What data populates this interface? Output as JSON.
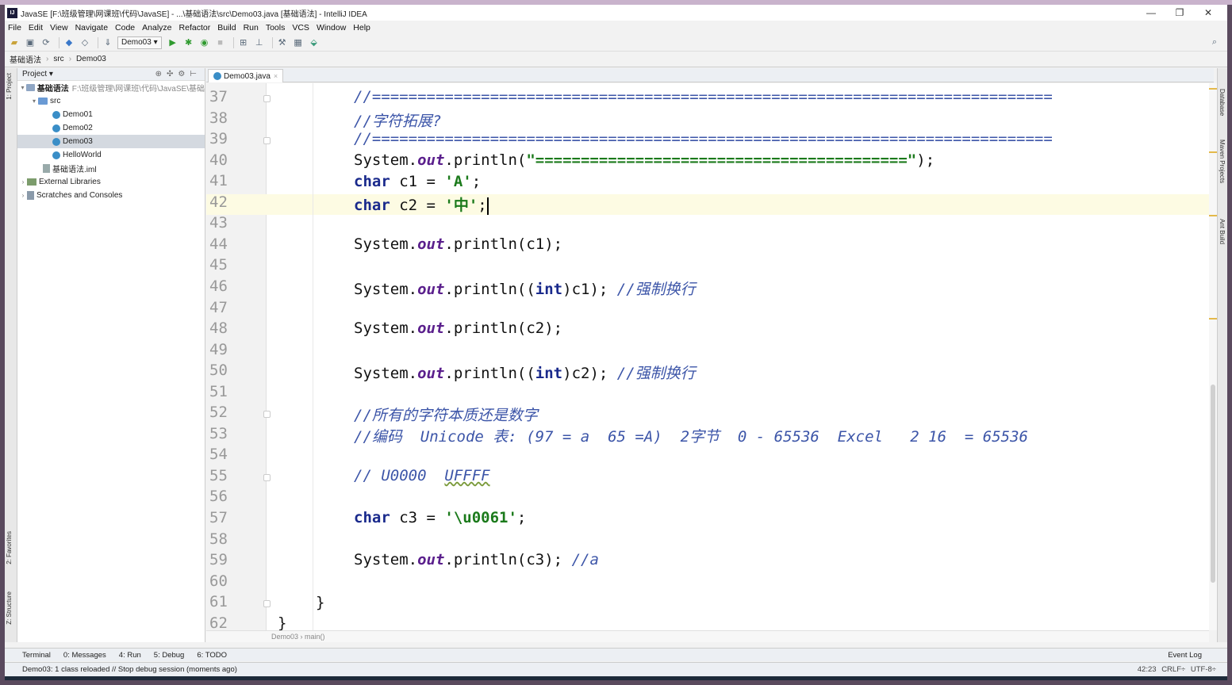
{
  "window": {
    "title": "JavaSE [F:\\班级管理\\网课班\\代码\\JavaSE] - ...\\基础语法\\src\\Demo03.java [基础语法] - IntelliJ IDEA",
    "controls": [
      "—",
      "❐",
      "✕"
    ]
  },
  "menu": [
    "File",
    "Edit",
    "View",
    "Navigate",
    "Code",
    "Analyze",
    "Refactor",
    "Build",
    "Run",
    "Tools",
    "VCS",
    "Window",
    "Help"
  ],
  "toolbar": {
    "run_config": "Demo03 ▾"
  },
  "breadcrumbs": [
    "基础语法",
    "src",
    "Demo03"
  ],
  "left_stripe": {
    "project": "1: Project",
    "favorites": "2: Favorites",
    "structure": "Z: Structure"
  },
  "project_panel": {
    "title": "Project ▾",
    "root": {
      "name": "基础语法",
      "path": "F:\\班级管理\\网课班\\代码\\JavaSE\\基础"
    },
    "src": "src",
    "files": [
      "Demo01",
      "Demo02",
      "Demo03",
      "HelloWorld"
    ],
    "iml": "基础语法.iml",
    "external": "External Libraries",
    "scratches": "Scratches and Consoles"
  },
  "editor": {
    "tab": "Demo03.java",
    "line_numbers": [
      "37",
      "38",
      "39",
      "40",
      "41",
      "42",
      "43",
      "44",
      "45",
      "46",
      "47",
      "48",
      "49",
      "50",
      "51",
      "52",
      "53",
      "54",
      "55",
      "56",
      "57",
      "58",
      "59",
      "60",
      "61",
      "62"
    ],
    "code": {
      "l37": "//===========================================================================",
      "l38": "//字符拓展?",
      "l39": "//===========================================================================",
      "l40_a": "System.",
      "l40_b": "out",
      "l40_c": ".println(",
      "l40_d": "\"=========================================\"",
      "l40_e": ");",
      "kw_char": "char",
      "l41_a": " c1 = ",
      "l41_b": "'A'",
      "l41_c": ";",
      "l42_a": " c2 = ",
      "l42_b": "'中'",
      "l42_c": ";",
      "l44_a": "System.",
      "l44_b": "out",
      "l44_c": ".println(c1);",
      "l46_a": "System.",
      "l46_b": "out",
      "l46_c": ".println((",
      "kw_int": "int",
      "l46_d": ")c1); ",
      "l46_e": "//强制换行",
      "l48_a": "System.",
      "l48_b": "out",
      "l48_c": ".println(c2);",
      "l50_a": "System.",
      "l50_b": "out",
      "l50_c": ".println((",
      "l50_d": ")c2); ",
      "l50_e": "//强制换行",
      "l52": "//所有的字符本质还是数字",
      "l53": "//编码  Unicode 表: (97 = a  65 =A)  2字节  0 - 65536  Excel   2 16  = 65536",
      "l55_a": "// U0000  ",
      "l55_b": "UFFFF",
      "l57_a": " c3 = ",
      "l57_b": "'\\u0061'",
      "l57_c": ";",
      "l59_a": "System.",
      "l59_b": "out",
      "l59_c": ".println(c3); ",
      "l59_d": "//a",
      "l61": "}",
      "l62": "}"
    },
    "breadcrumb": "Demo03  ›  main()"
  },
  "right_stripe": [
    "Database",
    "Maven Projects",
    "Ant Build"
  ],
  "bottom_tabs": [
    "Terminal",
    "0: Messages",
    "4: Run",
    "5: Debug",
    "6: TODO"
  ],
  "event_log": "Event Log",
  "status": {
    "message": "Demo03: 1 class reloaded // Stop debug session (moments ago)",
    "position": "42:23",
    "line_sep": "CRLF÷",
    "encoding": "UTF-8÷"
  },
  "colors": {
    "keyword": "#1a2a8c",
    "comment": "#3c55a8",
    "string": "#1b7a1b",
    "field": "#5a1f8c",
    "current_line": "#fdfbe3"
  }
}
